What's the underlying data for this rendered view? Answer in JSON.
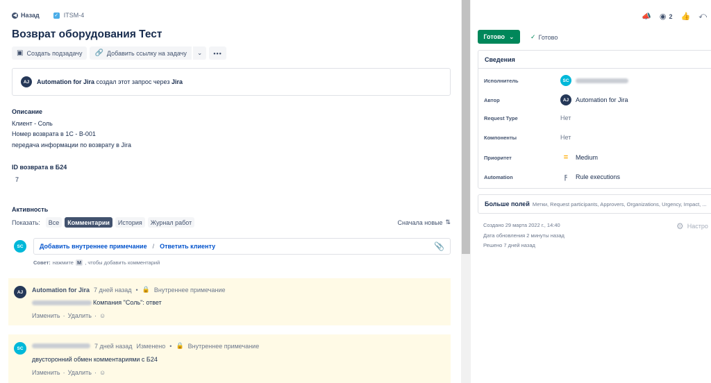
{
  "nav": {
    "back_label": "Назад",
    "issue_key": "ITSM-4"
  },
  "title": "Возврат оборудования Тест",
  "toolbar": {
    "create_subtask": "Создать подзадачу",
    "add_link": "Добавить ссылку на задачу",
    "more": "•••"
  },
  "created_via": {
    "initials": "AJ",
    "author": "Automation for Jira",
    "text": "создал этот запрос через",
    "channel": "Jira"
  },
  "description": {
    "heading": "Описание",
    "lines": [
      "Клиент - Соль",
      "Номер возврата в 1С - В-001",
      "передача информации по возврату в Jira"
    ]
  },
  "id_field": {
    "heading": "ID возврата в Б24",
    "value": "7"
  },
  "activity": {
    "heading": "Активность",
    "show_label": "Показать:",
    "filters": [
      "Все",
      "Комментарии",
      "История",
      "Журнал работ"
    ],
    "active_filter": "Комментарии",
    "sort_label": "Сначала новые"
  },
  "comment_box": {
    "avatar": "SC",
    "internal_note": "Добавить внутреннее примечание",
    "separator": "/",
    "reply": "Ответить клиенту",
    "tip_prefix": "Совет:",
    "tip_middle": "нажмите",
    "tip_key": "M",
    "tip_suffix": ", чтобы добавить комментарий"
  },
  "comments": [
    {
      "initials": "AJ",
      "author": "Automation for Jira",
      "time": "7 дней назад",
      "edited": "",
      "visibility": "Внутреннее примечание",
      "body": "Компания \"Соль\": ответ",
      "actions": [
        "Изменить",
        "Удалить"
      ]
    },
    {
      "initials": "SC",
      "author": "",
      "time": "7 дней назад",
      "edited": "Изменено",
      "visibility": "Внутреннее примечание",
      "body": "двусторонний обмен комментариями с Б24",
      "actions": [
        "Изменить",
        "Удалить"
      ]
    }
  ],
  "right": {
    "watchers": "2",
    "status": "Готово",
    "transition": "Готово",
    "details_heading": "Сведения",
    "fields": [
      {
        "label": "Исполнитель",
        "value": "",
        "avatar": "SC"
      },
      {
        "label": "Автор",
        "value": "Automation for Jira",
        "avatar": "AJ"
      },
      {
        "label": "Request Type",
        "value": "Нет"
      },
      {
        "label": "Компоненты",
        "value": "Нет"
      },
      {
        "label": "Приоритет",
        "value": "Medium"
      },
      {
        "label": "Automation",
        "value": "Rule executions"
      }
    ],
    "more_fields": "Больше полей",
    "more_fields_list": "Метки, Request participants, Approvers, Organizations, Urgency, Impact, ...",
    "created": "Создано 29 марта 2022 г., 14:40",
    "updated": "Дата обновления 2 минуты назад",
    "resolved": "Решено 7 дней назад",
    "configure": "Настро"
  },
  "colors": {
    "status_green": "#00875A",
    "comment_bg": "#FFFAE6",
    "link_blue": "#0052CC",
    "priority_medium": "#FFAB00"
  },
  "icons": [
    "back-arrow-icon",
    "issue-type-icon",
    "subtask-icon",
    "link-icon",
    "chevron-down-icon",
    "announce-icon",
    "eye-icon",
    "thumbs-up-icon",
    "share-icon",
    "check-icon",
    "priority-medium-icon",
    "bolt-icon",
    "paperclip-icon",
    "lock-icon",
    "emoji-icon",
    "gear-icon",
    "sort-icon"
  ]
}
